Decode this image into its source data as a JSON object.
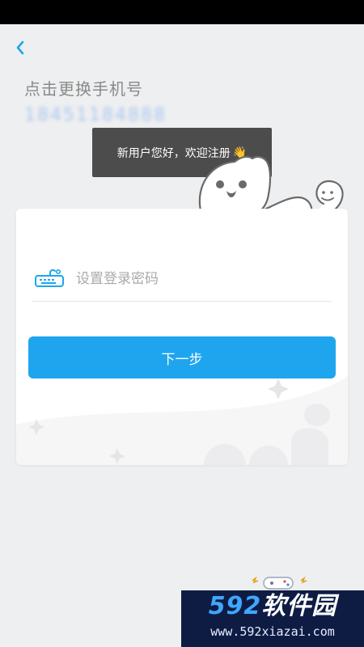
{
  "header": {
    "back_icon": "chevron-left-icon",
    "title": "点击更换手机号",
    "phone": "18451184888"
  },
  "tooltip": {
    "text": "新用户您好，欢迎注册",
    "emoji": "👋"
  },
  "form": {
    "password_placeholder": "设置登录密码",
    "password_value": "",
    "password_icon": "password-keyboard-icon",
    "next_label": "下一步"
  },
  "watermark": {
    "title_number": "592",
    "title_text": "软件园",
    "url": "www.592xiazai.com"
  },
  "colors": {
    "accent": "#1ea5ee",
    "background": "#eeeff0",
    "tooltip_bg": "#4c4c4c"
  }
}
